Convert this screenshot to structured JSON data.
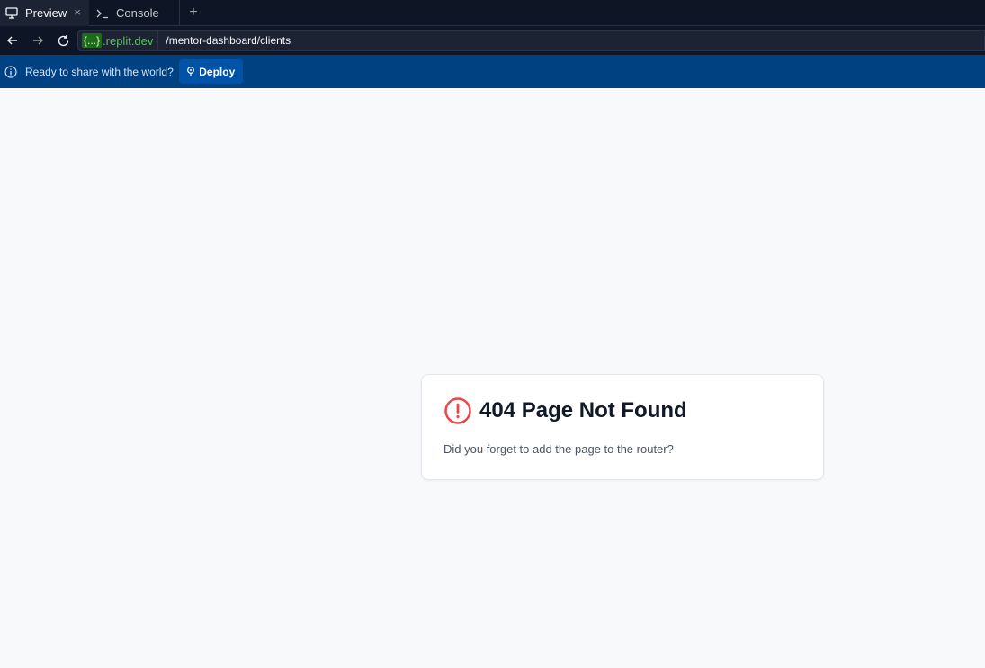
{
  "tabs": [
    {
      "label": "Preview",
      "icon": "monitor-icon",
      "active": true,
      "close": "×"
    },
    {
      "label": "Console",
      "icon": "terminal-icon",
      "active": false
    }
  ],
  "new_tab_label": "+",
  "address": {
    "domain_badge": "{...}",
    "domain": ".replit.dev",
    "path": "/mentor-dashboard/clients"
  },
  "banner": {
    "text": "Ready to share with the world?",
    "deploy_label": "Deploy"
  },
  "card": {
    "title": "404 Page Not Found",
    "message": "Did you forget to add the page to the router?"
  },
  "colors": {
    "chrome_bg": "#0e1525",
    "banner_bg": "#004182",
    "error_red": "#ef4444",
    "page_bg": "#f8f9fb"
  }
}
